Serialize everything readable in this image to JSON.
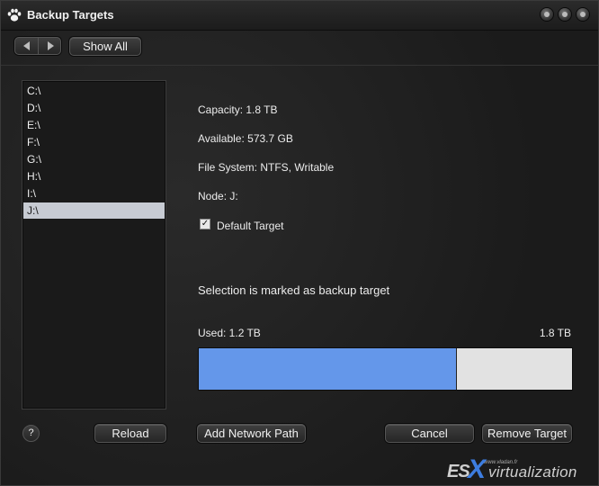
{
  "window": {
    "title": "Backup Targets",
    "icon": "paw-icon"
  },
  "toolbar": {
    "back_icon": "arrow-left-icon",
    "forward_icon": "arrow-right-icon",
    "show_all_label": "Show All"
  },
  "drives": [
    {
      "label": "C:\\",
      "selected": false
    },
    {
      "label": "D:\\",
      "selected": false
    },
    {
      "label": "E:\\",
      "selected": false
    },
    {
      "label": "F:\\",
      "selected": false
    },
    {
      "label": "G:\\",
      "selected": false
    },
    {
      "label": "H:\\",
      "selected": false
    },
    {
      "label": "I:\\",
      "selected": false
    },
    {
      "label": "J:\\",
      "selected": true
    }
  ],
  "details": {
    "capacity": "Capacity: 1.8 TB",
    "available": "Available: 573.7 GB",
    "file_system": "File System: NTFS, Writable",
    "node": "Node: J:",
    "default_target_label": "Default Target",
    "default_target_checked": true,
    "status": "Selection is marked as backup target"
  },
  "usage": {
    "used_label": "Used: 1.2 TB",
    "total_label": "1.8 TB",
    "used_fraction": 0.69,
    "used_color": "#6497ea",
    "free_color": "#e2e2e2"
  },
  "buttons": {
    "help": "?",
    "reload": "Reload",
    "add_network_path": "Add Network Path",
    "cancel": "Cancel",
    "remove_target": "Remove Target"
  },
  "watermark": {
    "small": "www.vladan.fr",
    "brand_es": "ES",
    "brand_x": "X",
    "brand_rest": "virtualization"
  }
}
